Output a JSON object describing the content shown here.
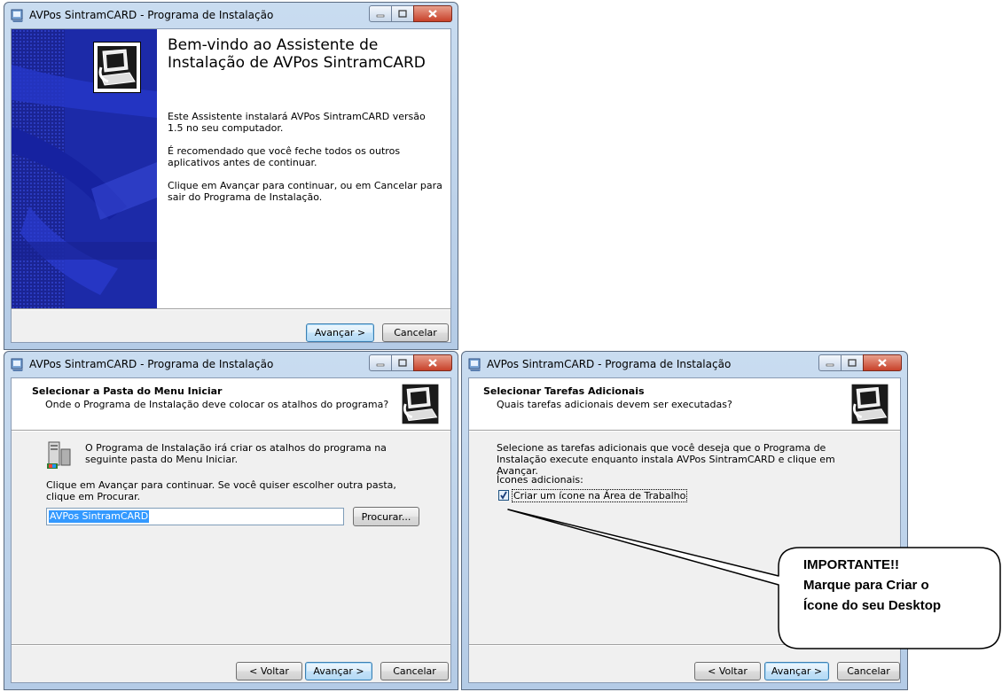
{
  "window_title": "AVPos SintramCARD - Programa de Instalação",
  "welcome": {
    "heading": "Bem-vindo ao Assistente de Instalação de AVPos SintramCARD",
    "para1": "Este Assistente instalará AVPos SintramCARD versão 1.5 no seu computador.",
    "para2": "É recomendado que você feche todos os outros aplicativos antes de continuar.",
    "para3": "Clique em Avançar para continuar, ou em Cancelar para sair do Programa de Instalação.",
    "next_label": "Avançar >",
    "cancel_label": "Cancelar"
  },
  "menu_folder": {
    "header_title": "Selecionar a Pasta do Menu Iniciar",
    "header_sub": "Onde o Programa de Instalação deve colocar os atalhos do programa?",
    "info": "O Programa de Instalação irá criar os atalhos do programa na seguinte pasta do Menu Iniciar.",
    "instructions": "Clique em Avançar para continuar. Se você quiser escolher outra pasta, clique em Procurar.",
    "folder_value": "AVPos SintramCARD",
    "browse_label": "Procurar...",
    "back_label": "< Voltar",
    "next_label": "Avançar >",
    "cancel_label": "Cancelar"
  },
  "tasks": {
    "header_title": "Selecionar Tarefas Adicionais",
    "header_sub": "Quais tarefas adicionais devem ser executadas?",
    "intro": "Selecione as tarefas adicionais que você deseja que o Programa de Instalação execute enquanto instala AVPos SintramCARD e clique em Avançar.",
    "group_label": "Ícones adicionais:",
    "checkbox_label": "Criar um ícone na Área de Trabalho",
    "checkbox_checked": true,
    "back_label": "< Voltar",
    "next_label": "Avançar >",
    "cancel_label": "Cancelar"
  },
  "callout": {
    "line1": "IMPORTANTE!!",
    "line2": "Marque para Criar o",
    "line3": "Ícone do seu Desktop"
  },
  "colors": {
    "wizard_sidebar": "#1c2aa8",
    "titlebar": "#c9dcf0",
    "close_button": "#c8412a",
    "selection": "#3399ff"
  },
  "icons": [
    "installer-icon",
    "minimize-icon",
    "maximize-icon",
    "close-icon",
    "computer-icon",
    "start-menu-folder-icon",
    "checkmark-icon"
  ]
}
